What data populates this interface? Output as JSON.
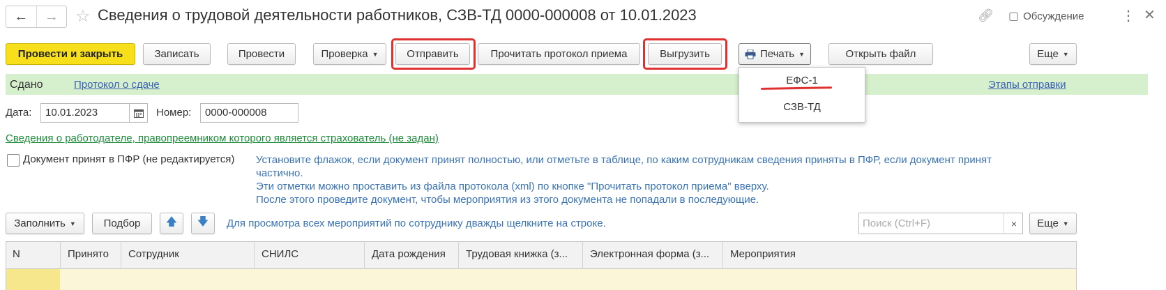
{
  "window": {
    "title": "Сведения о трудовой деятельности работников, СЗВ-ТД 0000-000008 от 10.01.2023",
    "back": "←",
    "forward": "→",
    "discussion": "Обсуждение"
  },
  "toolbar": {
    "post_close": "Провести и закрыть",
    "save": "Записать",
    "post": "Провести",
    "check": "Проверка",
    "send": "Отправить",
    "read_protocol": "Прочитать протокол приема",
    "export": "Выгрузить",
    "print": "Печать",
    "open_file": "Открыть файл",
    "more": "Еще"
  },
  "print_menu": {
    "items": [
      "ЕФС-1",
      "СЗВ-ТД"
    ]
  },
  "status": {
    "state": "Сдано",
    "protocol_link": "Протокол о сдаче",
    "stages_link": "Этапы отправки"
  },
  "form": {
    "date_label": "Дата:",
    "date_value": "10.01.2023",
    "number_label": "Номер:",
    "number_value": "0000-000008",
    "employer_link": "Сведения о работодателе, правопреемником которого является страхователь (не задан)",
    "accepted_checkbox": "Документ принят в ПФР (не редактируется)",
    "hint_lines": [
      "Установите флажок, если документ принят полностью, или отметьте в таблице, по каким сотрудникам сведения приняты в ПФР, если документ принят",
      "частично.",
      "Эти отметки можно проставить из файла протокола (xml) по кнопке \"Прочитать протокол приема\" вверху.",
      "После этого проведите документ, чтобы мероприятия из этого документа не попадали в последующие."
    ]
  },
  "table_toolbar": {
    "fill": "Заполнить",
    "select": "Подбор",
    "hint": "Для просмотра всех мероприятий по сотруднику дважды щелкните на строке.",
    "search_placeholder": "Поиск (Ctrl+F)",
    "search_clear": "×",
    "more": "Еще"
  },
  "table": {
    "columns": [
      "N",
      "Принято",
      "Сотрудник",
      "СНИЛС",
      "Дата рождения",
      "Трудовая книжка (з...",
      "Электронная форма (з...",
      "Мероприятия"
    ]
  },
  "colors": {
    "primary_button": "#f7e01b",
    "status_bg": "#d6f0cd",
    "highlight": "#e03131",
    "link": "#3a5fb3"
  }
}
